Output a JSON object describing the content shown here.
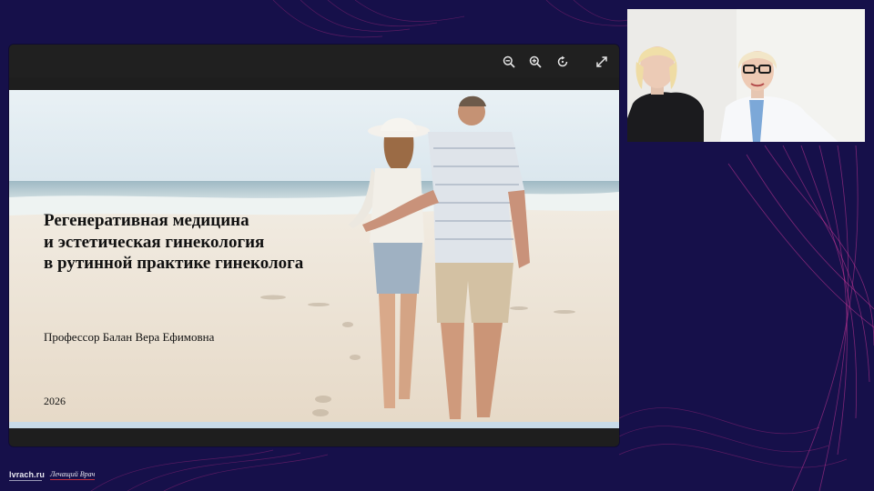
{
  "toolbar": {
    "buttons": [
      {
        "icon": "zoom-out-icon"
      },
      {
        "icon": "zoom-in-icon"
      },
      {
        "icon": "rotate-icon"
      },
      {
        "icon": "fullscreen-icon"
      }
    ]
  },
  "slide": {
    "title": "Регенеративная медицина\nи эстетическая гинекология\nв рутинной практике гинеколога",
    "author": "Профессор Балан Вера Ефимовна",
    "year": "2026"
  },
  "footer": {
    "logo_main": "lvrach.ru",
    "logo_second": "Лечащий Врач"
  },
  "colors": {
    "background": "#16104a",
    "accent_lines": "#c0308a",
    "toolbar": "#202020",
    "slide_bar": "#c9dbe8"
  }
}
